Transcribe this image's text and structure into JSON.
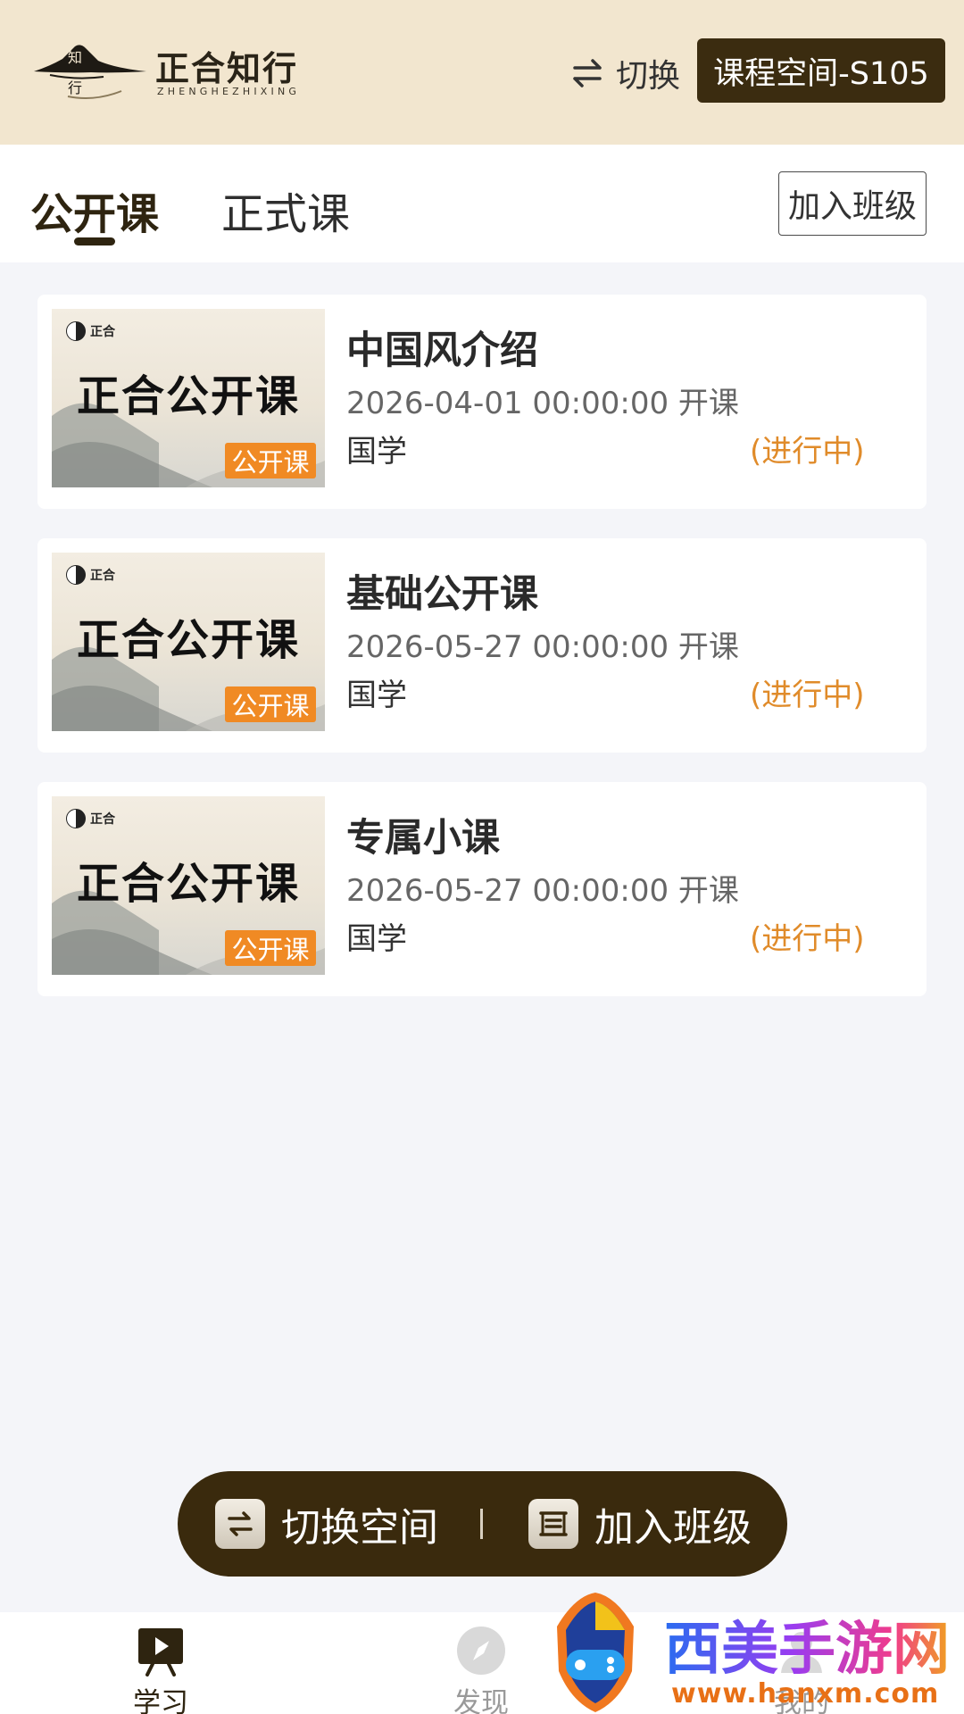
{
  "header": {
    "logo_mark_chars": [
      "知",
      "行"
    ],
    "logo_title": "正合知行",
    "logo_subtitle": "ZHENGHEZHIXING",
    "switch_label": "切换",
    "space_badge": "课程空间-S105"
  },
  "tabs": {
    "items": [
      {
        "label": "公开课",
        "active": true
      },
      {
        "label": "正式课",
        "active": false
      }
    ],
    "join_button": "加入班级"
  },
  "thumbnail": {
    "brand": "正合",
    "title": "正合公开课",
    "tag": "公开课"
  },
  "courses": [
    {
      "title": "中国风介绍",
      "time": "2026-04-01 00:00:00 开课",
      "category": "国学",
      "status": "(进行中)"
    },
    {
      "title": "基础公开课",
      "time": "2026-05-27 00:00:00 开课",
      "category": "国学",
      "status": "(进行中)"
    },
    {
      "title": "专属小课",
      "time": "2026-05-27 00:00:00 开课",
      "category": "国学",
      "status": "(进行中)"
    }
  ],
  "action_bar": {
    "switch_space": "切换空间",
    "join_class": "加入班级"
  },
  "bottom_nav": [
    {
      "label": "学习",
      "icon": "play-board-icon",
      "active": true
    },
    {
      "label": "发现",
      "icon": "compass-icon",
      "active": false
    },
    {
      "label": "我的",
      "icon": "user-icon",
      "active": false
    }
  ],
  "watermark": {
    "title": "西美手游网",
    "url": "www.hanxm.com"
  },
  "colors": {
    "header_bg": "#f2e6cf",
    "brand_dark": "#3b2c10",
    "status_orange": "#e08b2a",
    "tag_orange": "#f08a24",
    "page_bg": "#f4f5f9"
  }
}
